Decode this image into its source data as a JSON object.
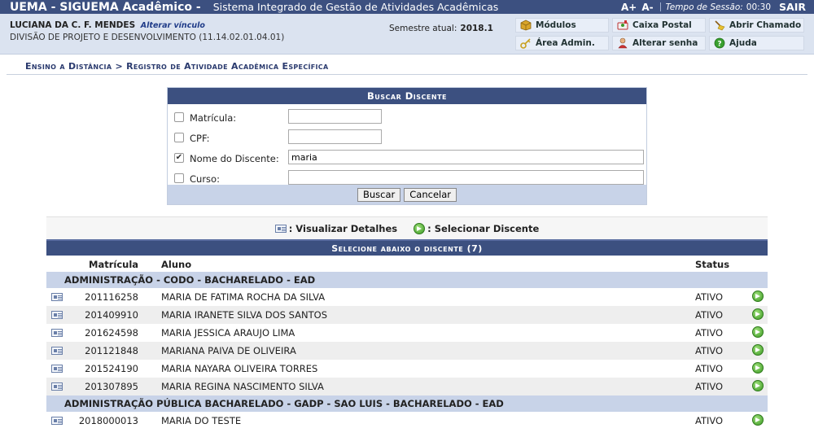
{
  "header": {
    "app_title": "UEMA - SIGUEMA Acadêmico -",
    "app_subtitle": "Sistema Integrado de Gestão de Atividades Acadêmicas",
    "font_increase": "A+",
    "font_decrease": "A-",
    "session_label": "Tempo de Sessão:",
    "session_time": "00:30",
    "logout": "SAIR"
  },
  "user": {
    "name": "LUCIANA DA C. F. MENDES",
    "change_link": "Alterar vínculo",
    "unit": "DIVISÃO DE PROJETO E DESENVOLVIMENTO (11.14.02.01.04.01)",
    "semester_label": "Semestre atual:",
    "semester_value": "2018.1"
  },
  "quick_menu": {
    "modulos": "Módulos",
    "caixa_postal": "Caixa Postal",
    "abrir_chamado": "Abrir Chamado",
    "area_admin": "Área Admin.",
    "alterar_senha": "Alterar senha",
    "ajuda": "Ajuda"
  },
  "breadcrumb": "Ensino a Distância > Registro de Atividade Acadêmica Específica",
  "search": {
    "caption": "Buscar Discente",
    "fields": [
      {
        "label": "Matrícula:",
        "value": "",
        "checked": false
      },
      {
        "label": "CPF:",
        "value": "",
        "checked": false
      },
      {
        "label": "Nome do Discente:",
        "value": "maria",
        "checked": true
      },
      {
        "label": "Curso:",
        "value": "",
        "checked": false
      }
    ],
    "search_button": "Buscar",
    "cancel_button": "Cancelar"
  },
  "legend": {
    "view_details": ": Visualizar Detalhes",
    "select_student": ": Selecionar Discente"
  },
  "results": {
    "caption": "Selecione abaixo o discente (7)",
    "columns": {
      "matricula": "Matrícula",
      "aluno": "Aluno",
      "status": "Status"
    },
    "groups": [
      {
        "course": "ADMINISTRAÇÃO - CODO - BACHARELADO - EAD",
        "rows": [
          {
            "matricula": "201116258",
            "name": "MARIA DE FATIMA ROCHA DA SILVA",
            "status": "ATIVO"
          },
          {
            "matricula": "201409910",
            "name": "MARIA IRANETE SILVA DOS SANTOS",
            "status": "ATIVO"
          },
          {
            "matricula": "201624598",
            "name": "MARIA JESSICA ARAUJO LIMA",
            "status": "ATIVO"
          },
          {
            "matricula": "201121848",
            "name": "MARIANA PAIVA DE OLIVEIRA",
            "status": "ATIVO"
          },
          {
            "matricula": "201524190",
            "name": "MARIA NAYARA OLIVEIRA TORRES",
            "status": "ATIVO"
          },
          {
            "matricula": "201307895",
            "name": "MARIA REGINA NASCIMENTO SILVA",
            "status": "ATIVO"
          }
        ]
      },
      {
        "course": "ADMINISTRAÇÃO PÚBLICA BACHARELADO - GADP - SAO LUIS - BACHARELADO - EAD",
        "rows": [
          {
            "matricula": "2018000013",
            "name": "MARIA DO TESTE",
            "status": "ATIVO"
          }
        ]
      }
    ]
  }
}
